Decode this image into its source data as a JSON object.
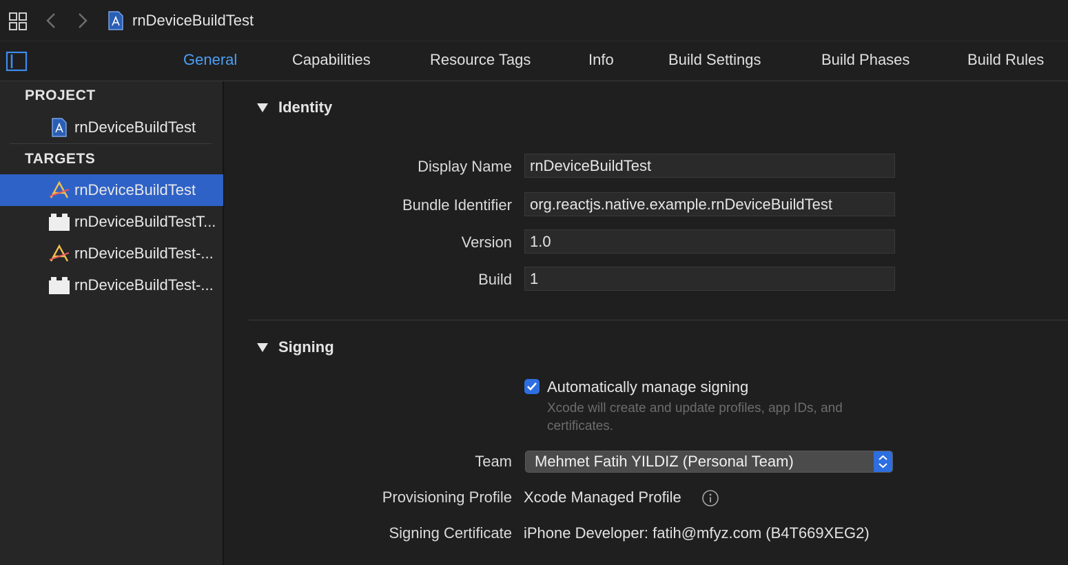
{
  "breadcrumb": {
    "title": "rnDeviceBuildTest"
  },
  "tabs": [
    {
      "label": "General",
      "active": true
    },
    {
      "label": "Capabilities"
    },
    {
      "label": "Resource Tags"
    },
    {
      "label": "Info"
    },
    {
      "label": "Build Settings"
    },
    {
      "label": "Build Phases"
    },
    {
      "label": "Build Rules"
    }
  ],
  "sidebar": {
    "project_header": "PROJECT",
    "project_item": "rnDeviceBuildTest",
    "targets_header": "TARGETS",
    "targets": [
      {
        "label": "rnDeviceBuildTest",
        "icon": "app-target-icon",
        "selected": true
      },
      {
        "label": "rnDeviceBuildTestT...",
        "icon": "test-bundle-icon"
      },
      {
        "label": "rnDeviceBuildTest-...",
        "icon": "app-target-icon"
      },
      {
        "label": "rnDeviceBuildTest-...",
        "icon": "test-bundle-icon"
      }
    ]
  },
  "identity": {
    "title": "Identity",
    "display_name_label": "Display Name",
    "display_name": "rnDeviceBuildTest",
    "bundle_id_label": "Bundle Identifier",
    "bundle_id": "org.reactjs.native.example.rnDeviceBuildTest",
    "version_label": "Version",
    "version": "1.0",
    "build_label": "Build",
    "build": "1"
  },
  "signing": {
    "title": "Signing",
    "auto_label": "Automatically manage signing",
    "auto_checked": true,
    "auto_help": "Xcode will create and update profiles, app IDs, and certificates.",
    "team_label": "Team",
    "team_value": "Mehmet Fatih YILDIZ (Personal Team)",
    "profile_label": "Provisioning Profile",
    "profile_value": "Xcode Managed Profile",
    "cert_label": "Signing Certificate",
    "cert_value": "iPhone Developer: fatih@mfyz.com (B4T669XEG2)"
  },
  "colors": {
    "accent": "#2d6ee0",
    "tab_active": "#4d9ff5",
    "selection": "#2f62c6"
  }
}
